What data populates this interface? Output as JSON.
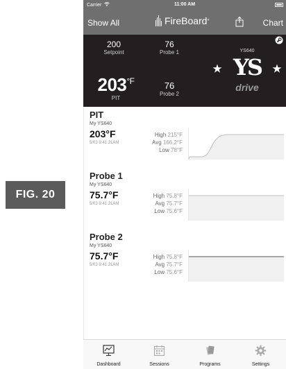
{
  "figure_label": "FIG. 20",
  "status_bar": {
    "carrier": "Carrier",
    "time": "11:00 AM"
  },
  "nav": {
    "left_label": "Show All",
    "title": "FireBoard",
    "title_mark": "°",
    "right_label": "Chart"
  },
  "dashboard": {
    "setpoint": {
      "value": "200",
      "label": "Setpoint"
    },
    "probe1": {
      "value": "76",
      "label": "Probe 1"
    },
    "pit": {
      "value": "203",
      "unit": "°F",
      "label": "PIT"
    },
    "probe2": {
      "value": "76",
      "label": "Probe 2"
    },
    "device_model": "YS640",
    "brand_letters": "YS",
    "brand_word": "drive"
  },
  "probes": [
    {
      "name": "PIT",
      "device": "My YS640",
      "temp": "203°F",
      "timestamp": "5/03 9:41:21AM",
      "high_label": "High",
      "high": "215°F",
      "avg_label": "Avg",
      "avg": "166.2°F",
      "low_label": "Low",
      "low": "78°F"
    },
    {
      "name": "Probe 1",
      "device": "My YS640",
      "temp": "75.7°F",
      "timestamp": "5/03 9:41:21AM",
      "high_label": "High",
      "high": "75.8°F",
      "avg_label": "Avg",
      "avg": "75.7°F",
      "low_label": "Low",
      "low": "75.6°F"
    },
    {
      "name": "Probe 2",
      "device": "My YS640",
      "temp": "75.7°F",
      "timestamp": "5/03 9:41:21AM",
      "high_label": "High",
      "high": "75.8°F",
      "avg_label": "Avg",
      "avg": "75.7°F",
      "low_label": "Low",
      "low": "75.6°F"
    }
  ],
  "tabs": [
    {
      "label": "Dashboard",
      "icon": "dashboard-icon"
    },
    {
      "label": "Sessions",
      "icon": "calendar-icon"
    },
    {
      "label": "Programs",
      "icon": "programs-icon"
    },
    {
      "label": "Settings",
      "icon": "gear-icon"
    }
  ],
  "colors": {
    "header": "#6f6f6f",
    "dashboard_bg": "#231f20",
    "tab_bar": "#f8f8f8"
  }
}
